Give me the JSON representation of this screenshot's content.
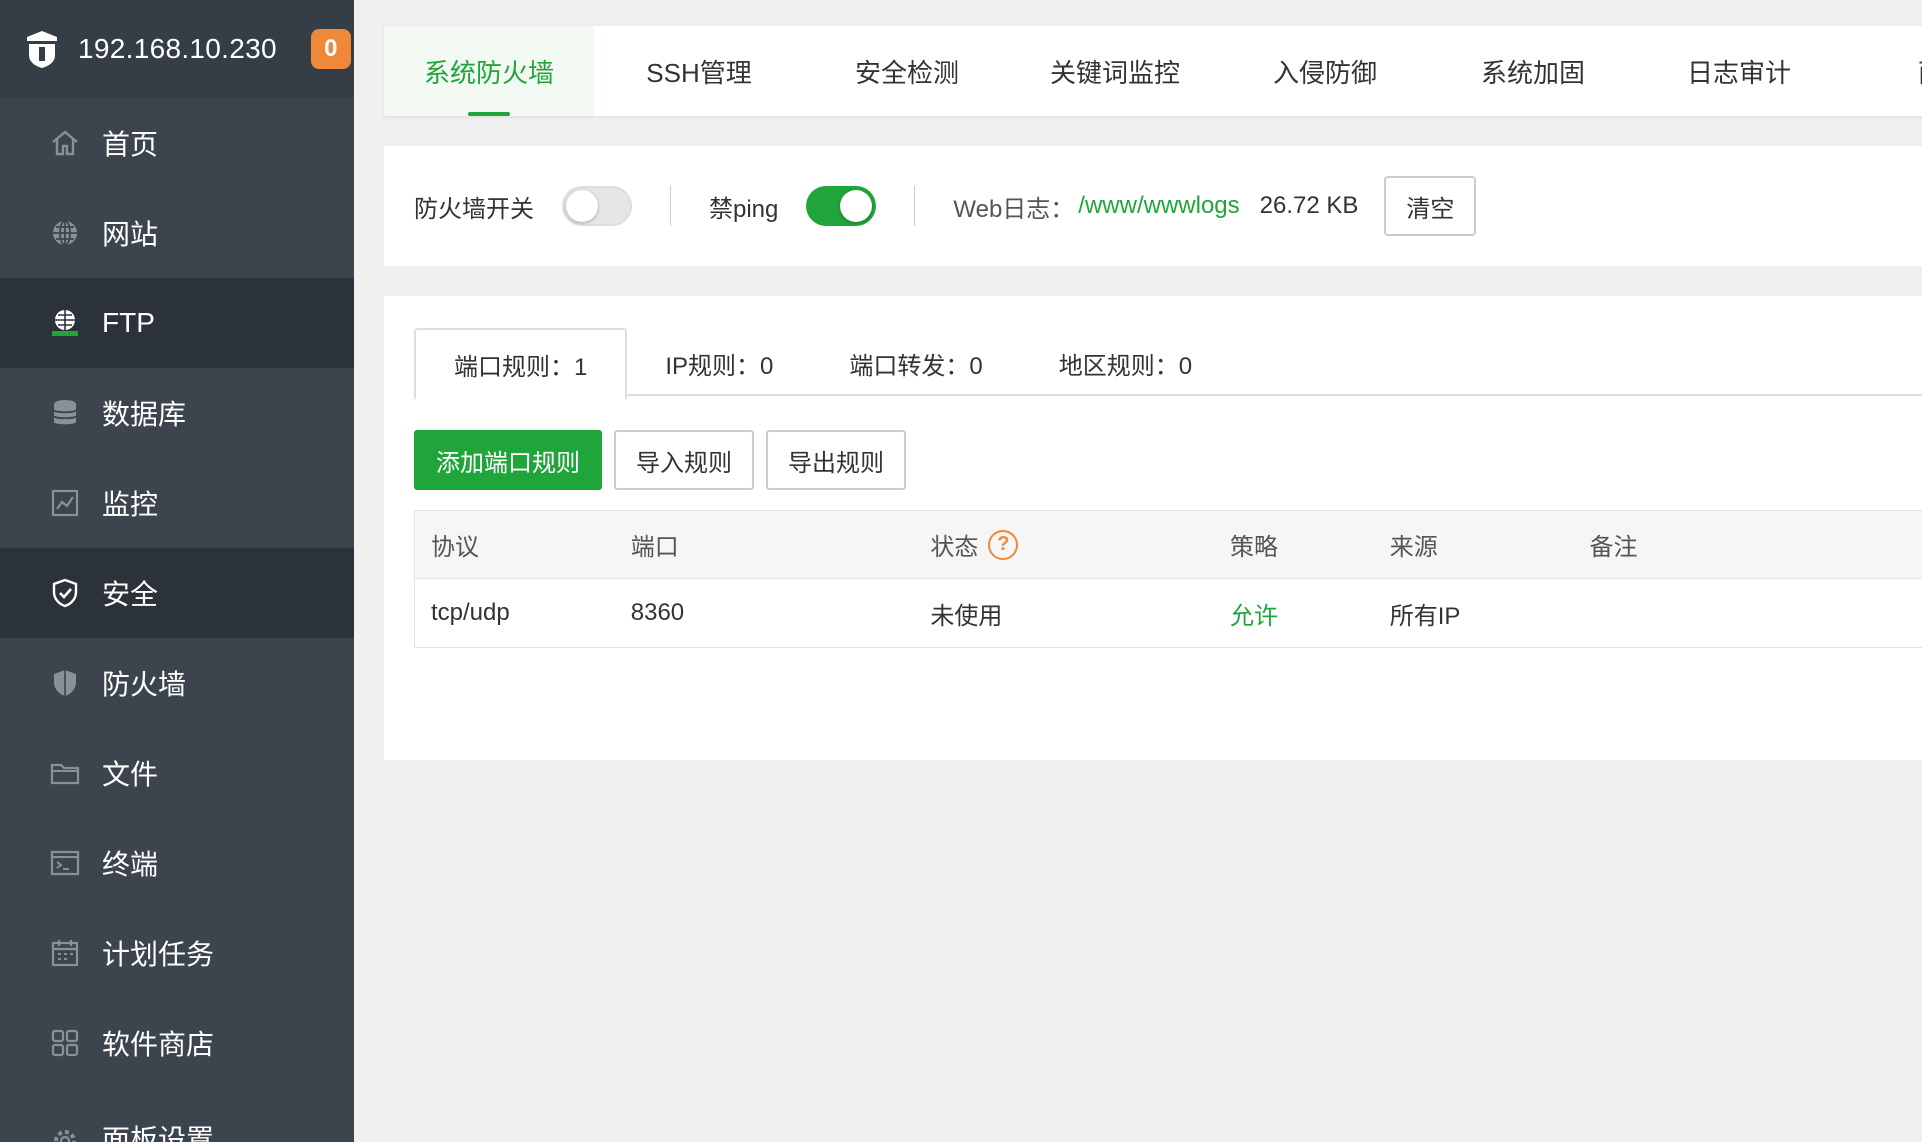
{
  "sidebar": {
    "ip": "192.168.10.230",
    "badge": "0",
    "items": [
      {
        "label": "首页",
        "icon": "home-icon"
      },
      {
        "label": "网站",
        "icon": "globe-icon"
      },
      {
        "label": "FTP",
        "icon": "ftp-icon"
      },
      {
        "label": "数据库",
        "icon": "database-icon"
      },
      {
        "label": "监控",
        "icon": "monitor-icon"
      },
      {
        "label": "安全",
        "icon": "shield-check-icon"
      },
      {
        "label": "防火墙",
        "icon": "firewall-icon"
      },
      {
        "label": "文件",
        "icon": "folder-icon"
      },
      {
        "label": "终端",
        "icon": "terminal-icon"
      },
      {
        "label": "计划任务",
        "icon": "calendar-icon"
      },
      {
        "label": "软件商店",
        "icon": "apps-icon"
      },
      {
        "label": "面板设置",
        "icon": "gear-icon"
      }
    ]
  },
  "top_tabs": [
    "系统防火墙",
    "SSH管理",
    "安全检测",
    "关键词监控",
    "入侵防御",
    "系统加固",
    "日志审计",
    "面"
  ],
  "settings": {
    "firewall_switch_label": "防火墙开关",
    "ping_label": "禁ping",
    "web_log_label": "Web日志：",
    "web_log_path": "/www/wwwlogs",
    "web_log_size": "26.72 KB",
    "clear_button": "清空"
  },
  "sub_tabs": [
    "端口规则：1",
    "IP规则：0",
    "端口转发：0",
    "地区规则：0"
  ],
  "actions": {
    "add": "添加端口规则",
    "import": "导入规则",
    "export": "导出规则"
  },
  "table": {
    "headers": [
      "协议",
      "端口",
      "状态",
      "策略",
      "来源",
      "备注"
    ],
    "help_glyph": "?",
    "rows": [
      {
        "protocol": "tcp/udp",
        "port": "8360",
        "status": "未使用",
        "policy": "允许",
        "source": "所有IP",
        "note": ""
      }
    ]
  },
  "colors": {
    "accent": "#20a53a",
    "sidebar_bg": "#3c444d",
    "badge": "#f0883a"
  }
}
